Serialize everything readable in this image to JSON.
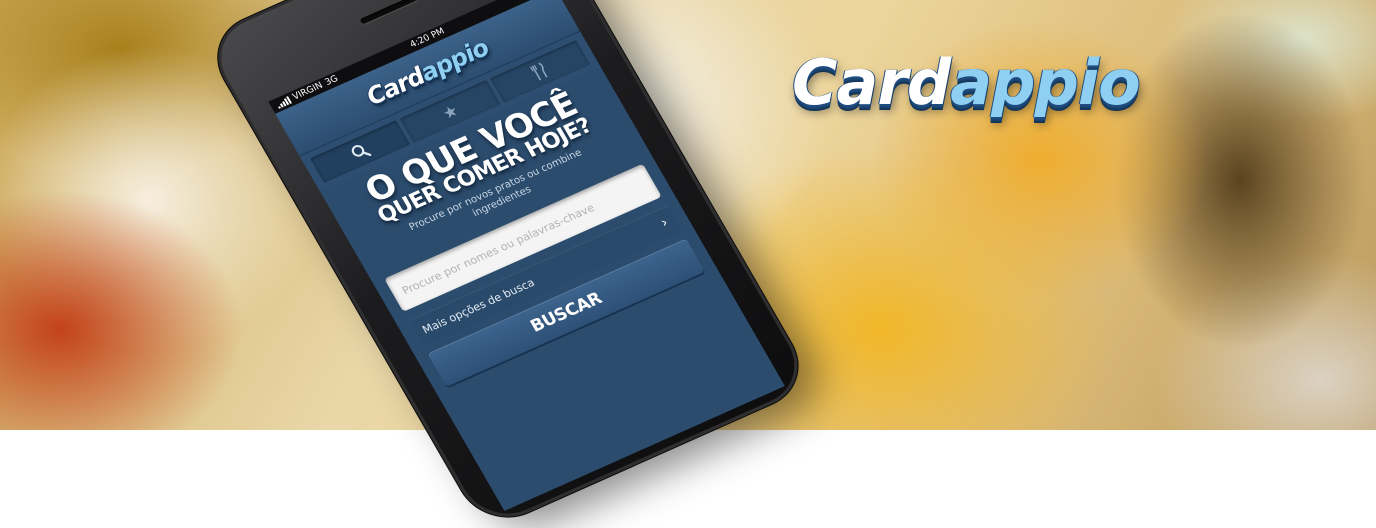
{
  "brand": {
    "logo_prefix": "Card",
    "logo_highlight": "appio"
  },
  "colors": {
    "app_blue": "#2c4c6e",
    "logo_highlight": "#8fd0f2",
    "header_blue": "#3c6289"
  },
  "phone": {
    "status_bar": {
      "carrier": "VIRGIN",
      "network": "3G",
      "time": "4:20 PM"
    },
    "header": {
      "logo_prefix": "Card",
      "logo_highlight": "appio"
    },
    "tabs": [
      {
        "icon": "search-icon",
        "active": true
      },
      {
        "icon": "star-icon",
        "active": false
      },
      {
        "icon": "fork-knife-icon",
        "active": false
      }
    ],
    "hero": {
      "headline_line1": "O QUE VOCÊ",
      "headline_line2": "QUER COMER HOJE?",
      "subtitle": "Procure por novos pratos ou combine ingredientes"
    },
    "search": {
      "placeholder": "Procure por nomes ou palavras-chave",
      "value": ""
    },
    "more_options": {
      "label": "Mais opções de busca"
    },
    "submit": {
      "label": "BUSCAR"
    }
  }
}
